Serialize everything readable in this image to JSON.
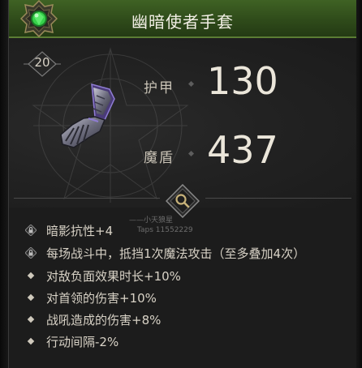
{
  "item": {
    "name": "幽暗使者手套",
    "level": "20",
    "header_color": "#3a5a22",
    "gem_color": "#36d14a"
  },
  "stats": [
    {
      "label": "护甲",
      "value": "130"
    },
    {
      "label": "魔盾",
      "value": "437"
    }
  ],
  "watermark": {
    "line1": "——小天狼星",
    "line2": "Taps 11552229"
  },
  "inspect_icon": "magnifier-icon",
  "properties": [
    {
      "icon": "lock-icon",
      "text": "暗影抗性+4"
    },
    {
      "icon": "lock-icon",
      "text": "每场战斗中，抵挡1次魔法攻击（至多叠加4次）"
    },
    {
      "icon": "diamond-bullet-icon",
      "text": "对敌负面效果时长+10%"
    },
    {
      "icon": "diamond-bullet-icon",
      "text": "对首领的伤害+10%"
    },
    {
      "icon": "diamond-bullet-icon",
      "text": "战吼造成的伤害+8%"
    },
    {
      "icon": "diamond-bullet-icon",
      "text": "行动间隔-2%"
    }
  ]
}
